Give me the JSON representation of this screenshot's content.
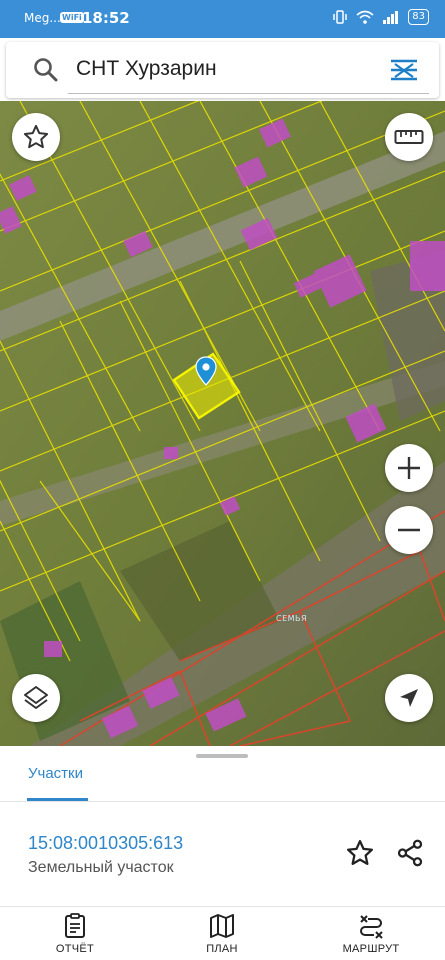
{
  "status_bar": {
    "carrier": "Meg...",
    "wifi_badge": "WiFi",
    "time": "18:52",
    "battery": "83"
  },
  "search": {
    "query": "СНТ Хурзарин"
  },
  "map": {
    "place_label": "СЕМЬЯ",
    "colors": {
      "parcel_border": "#e8e000",
      "selected_parcel": "#e6e600",
      "building_fill": "#c04ec4",
      "boundary_red": "#e0432b",
      "pin": "#1e90d6"
    }
  },
  "map_controls": {
    "favorite": "star-icon",
    "ruler": "ruler-icon",
    "zoom_in": "plus-icon",
    "zoom_out": "minus-icon",
    "layers": "layers-icon",
    "locate": "navigation-arrow-icon"
  },
  "sheet": {
    "tab_label": "Участки",
    "parcel_id": "15:08:0010305:613",
    "parcel_type": "Земельный участок"
  },
  "bottom_nav": {
    "items": [
      {
        "label": "ОТЧЁТ",
        "icon": "report-icon"
      },
      {
        "label": "ПЛАН",
        "icon": "map-plan-icon"
      },
      {
        "label": "МАРШРУТ",
        "icon": "route-icon"
      }
    ]
  }
}
